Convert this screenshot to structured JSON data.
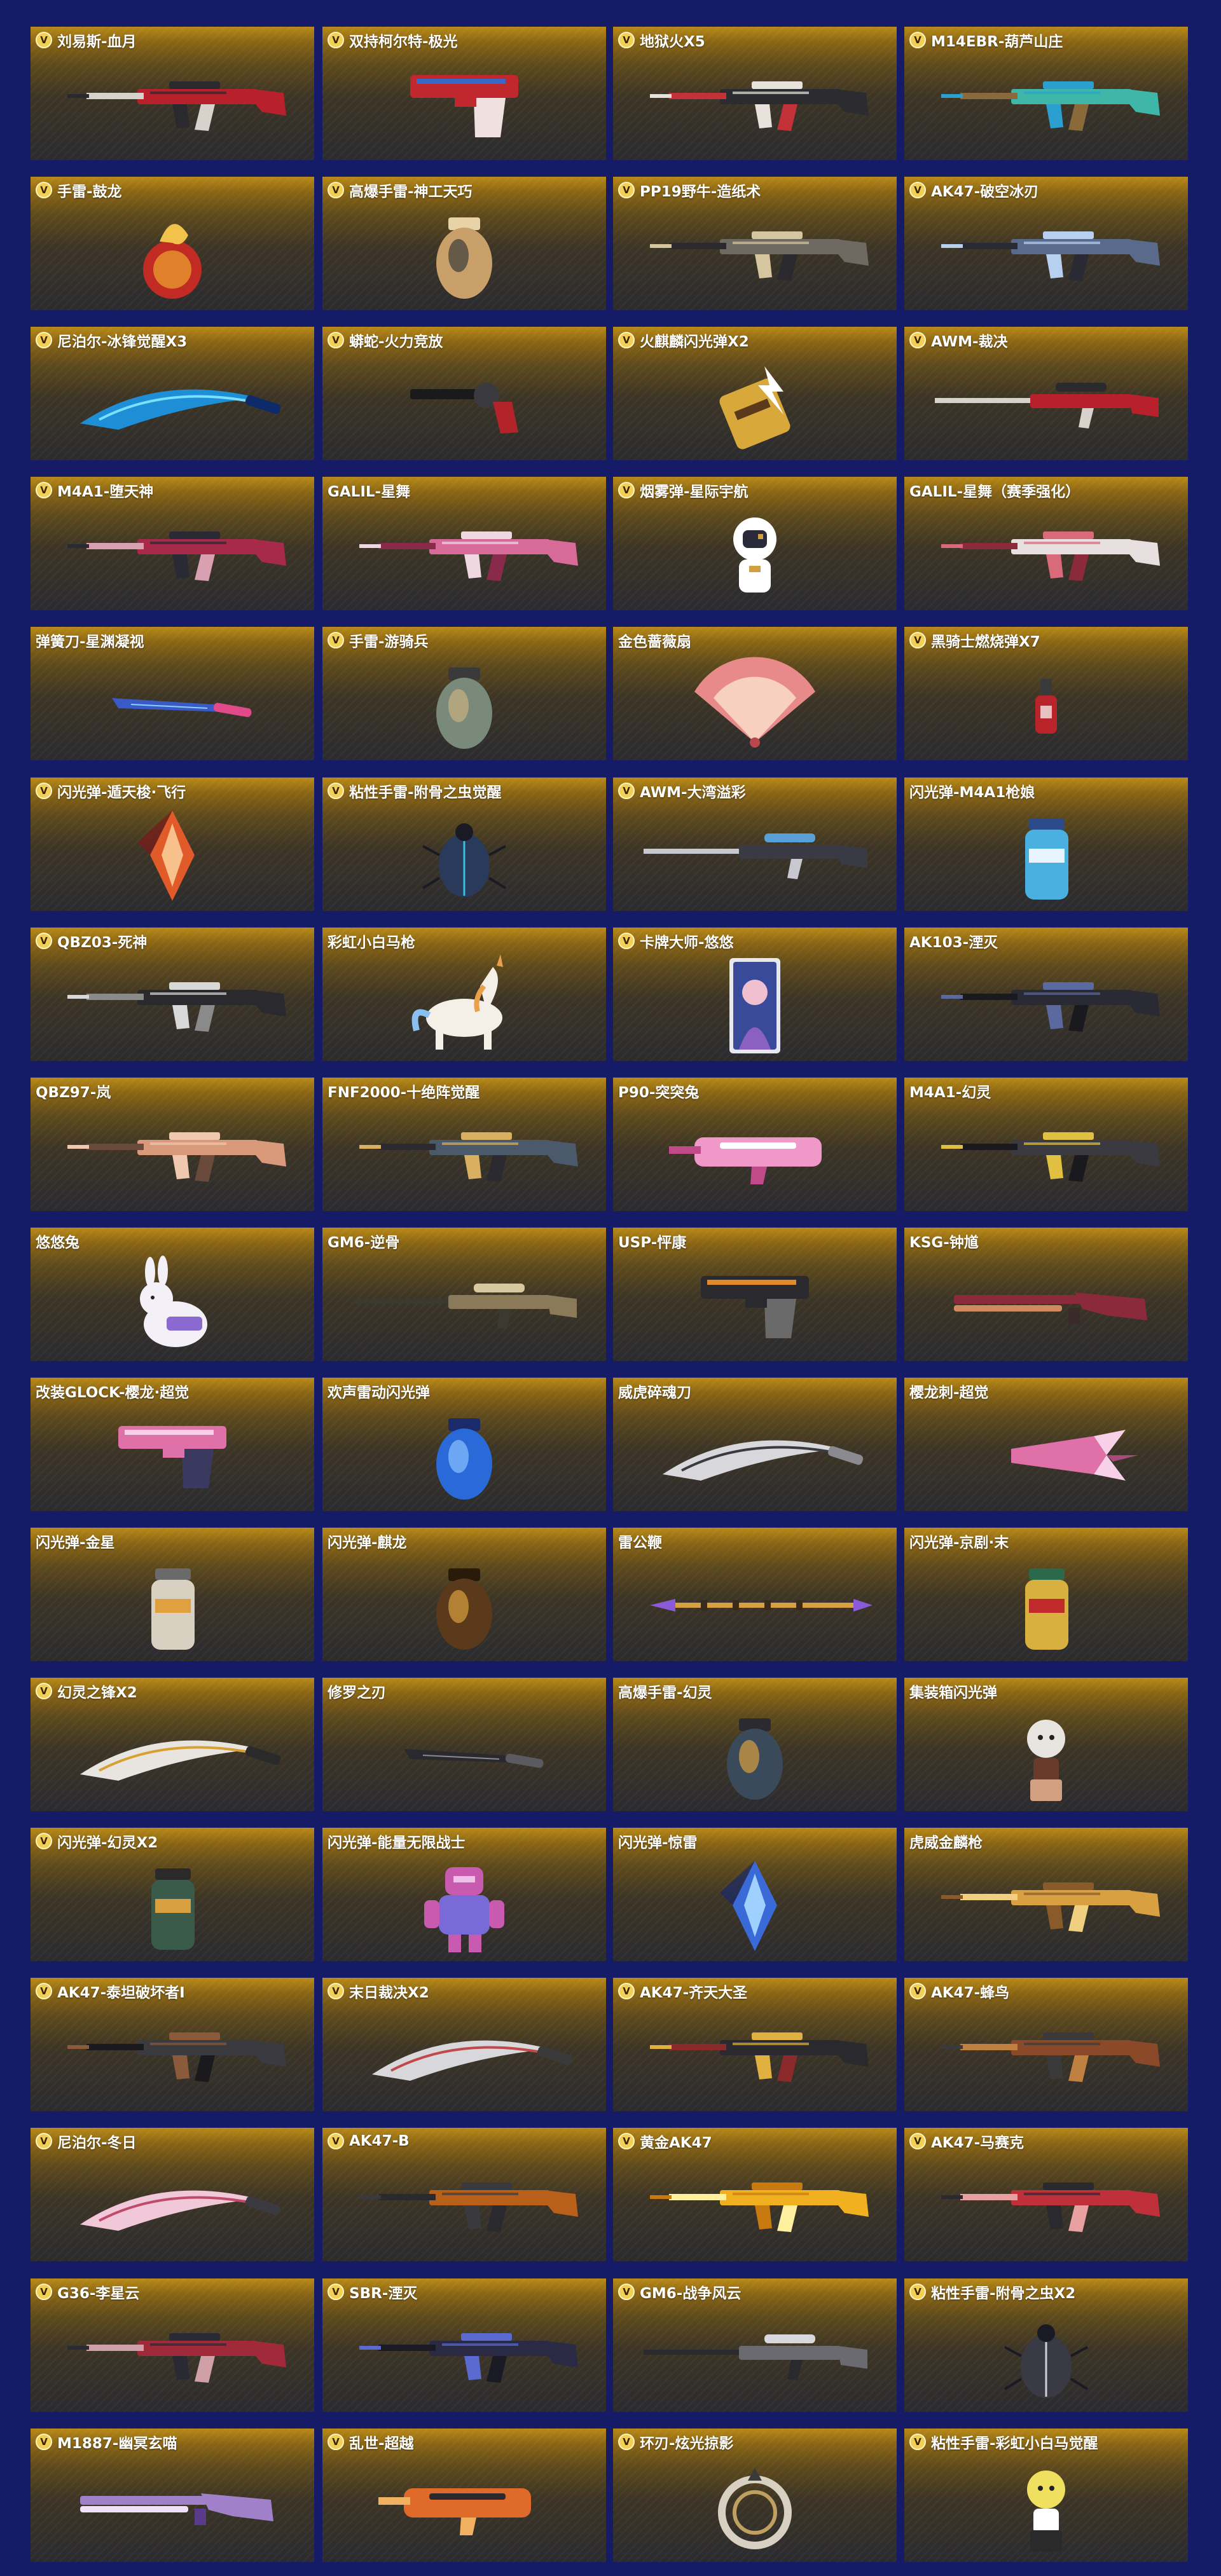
{
  "grid": {
    "items": [
      {
        "name": "刘易斯-血月",
        "badge": "V",
        "icon": "rifle-icon",
        "colors": [
          "#b8212b",
          "#2a2a2e",
          "#d8d2cc"
        ]
      },
      {
        "name": "双持柯尔特-极光",
        "badge": "V",
        "icon": "pistol-icon",
        "colors": [
          "#c0272e",
          "#3a68c8",
          "#f0e0e0"
        ]
      },
      {
        "name": "地狱火X5",
        "badge": "V",
        "icon": "rifle-icon",
        "colors": [
          "#2c2c30",
          "#e8e2dc",
          "#c23238"
        ]
      },
      {
        "name": "M14EBR-葫芦山庄",
        "badge": "V",
        "icon": "rifle-icon",
        "colors": [
          "#3fb7a8",
          "#2b9fd0",
          "#8a6a3a"
        ]
      },
      {
        "name": "手雷-鼓龙",
        "badge": "V",
        "icon": "dragon-grenade-icon",
        "colors": [
          "#e0802a",
          "#c22a24",
          "#f2c24a"
        ]
      },
      {
        "name": "高爆手雷-神工天巧",
        "badge": "V",
        "icon": "grenade-icon",
        "colors": [
          "#c9a06a",
          "#3a3a3a",
          "#e8d2a8"
        ]
      },
      {
        "name": "PP19野牛-造纸术",
        "badge": "V",
        "icon": "rifle-icon",
        "colors": [
          "#6e6a62",
          "#d6c6a0",
          "#2a2a2e"
        ]
      },
      {
        "name": "AK47-破空冰刃",
        "badge": "V",
        "icon": "rifle-icon",
        "colors": [
          "#5a6a8a",
          "#b8d0f0",
          "#2a2a34"
        ]
      },
      {
        "name": "尼泊尔-冰锋觉醒X3",
        "badge": "V",
        "icon": "blade-icon",
        "colors": [
          "#1e8fd6",
          "#7ae0ff",
          "#0d2a6a"
        ]
      },
      {
        "name": "蟒蛇-火力竞放",
        "badge": "V",
        "icon": "revolver-icon",
        "colors": [
          "#3a3a40",
          "#b2242a",
          "#1a1a1a"
        ]
      },
      {
        "name": "火麒麟闪光弹X2",
        "badge": "V",
        "icon": "flashbang-icon",
        "colors": [
          "#d8a83a",
          "#5a3a1a",
          "#ffffff"
        ]
      },
      {
        "name": "AWM-裁决",
        "badge": "V",
        "icon": "sniper-icon",
        "colors": [
          "#b8212b",
          "#2a2a2e",
          "#d8d2cc"
        ]
      },
      {
        "name": "M4A1-堕天神",
        "badge": "V",
        "icon": "rifle-icon",
        "colors": [
          "#a82a4a",
          "#2a2a34",
          "#d8a0b0"
        ]
      },
      {
        "name": "GALIL-星舞",
        "badge": "",
        "icon": "rifle-icon",
        "colors": [
          "#d86a9a",
          "#f0d8e0",
          "#8a2a4a"
        ]
      },
      {
        "name": "烟雾弹-星际宇航",
        "badge": "V",
        "icon": "astronaut-icon",
        "colors": [
          "#ffffff",
          "#d0a040",
          "#2a2a3a"
        ]
      },
      {
        "name": "GALIL-星舞（赛季强化）",
        "badge": "",
        "icon": "rifle-icon",
        "colors": [
          "#e8e0e0",
          "#d86a7a",
          "#8a2a3a"
        ]
      },
      {
        "name": "弹簧刀-星渊凝视",
        "badge": "",
        "icon": "knife-icon",
        "colors": [
          "#3a5ac8",
          "#e04a8a",
          "#8ad0ff"
        ]
      },
      {
        "name": "手雷-游骑兵",
        "badge": "V",
        "icon": "grenade-icon",
        "colors": [
          "#7a8a7a",
          "#c8b080",
          "#3a3a3a"
        ]
      },
      {
        "name": "金色蔷薇扇",
        "badge": "",
        "icon": "fan-icon",
        "colors": [
          "#e88a8a",
          "#f8d0c0",
          "#b8484a"
        ]
      },
      {
        "name": "黑骑士燃烧弹X7",
        "badge": "V",
        "icon": "molotov-icon",
        "colors": [
          "#b8242a",
          "#3a3a3a",
          "#e8c0c0"
        ]
      },
      {
        "name": "闪光弹-遁天梭·飞行",
        "badge": "V",
        "icon": "crystal-icon",
        "colors": [
          "#e05a2a",
          "#f8c08a",
          "#7a1a1a"
        ]
      },
      {
        "name": "粘性手雷-附骨之虫觉醒",
        "badge": "V",
        "icon": "beetle-icon",
        "colors": [
          "#2a3a5a",
          "#3ac0e0",
          "#1a1a24"
        ]
      },
      {
        "name": "AWM-大湾溢彩",
        "badge": "V",
        "icon": "sniper-icon",
        "colors": [
          "#3a3a44",
          "#5aa0d8",
          "#c8c8d0"
        ]
      },
      {
        "name": "闪光弹-M4A1枪娘",
        "badge": "",
        "icon": "canister-icon",
        "colors": [
          "#4ab0e0",
          "#e8f4ff",
          "#2a4a8a"
        ]
      },
      {
        "name": "QBZ03-死神",
        "badge": "V",
        "icon": "rifle-icon",
        "colors": [
          "#2a2a2e",
          "#d8d8d8",
          "#8a8a8a"
        ]
      },
      {
        "name": "彩虹小白马枪",
        "badge": "",
        "icon": "unicorn-icon",
        "colors": [
          "#f4f0e8",
          "#e8a04a",
          "#8ac0f0"
        ]
      },
      {
        "name": "卡牌大师-悠悠",
        "badge": "V",
        "icon": "portrait-card-icon",
        "colors": [
          "#8a60c0",
          "#f0c0d0",
          "#3a4a9a"
        ]
      },
      {
        "name": "AK103-湮灭",
        "badge": "",
        "icon": "rifle-icon",
        "colors": [
          "#2a2a34",
          "#5a6aa0",
          "#1a1a1e"
        ]
      },
      {
        "name": "QBZ97-岚",
        "badge": "",
        "icon": "rifle-icon",
        "colors": [
          "#d89a7a",
          "#f0c8b0",
          "#6a4a3a"
        ]
      },
      {
        "name": "FNF2000-十绝阵觉醒",
        "badge": "",
        "icon": "rifle-icon",
        "colors": [
          "#4a5a6a",
          "#d8b060",
          "#2a2a30"
        ]
      },
      {
        "name": "P90-突突兔",
        "badge": "",
        "icon": "smg-icon",
        "colors": [
          "#f098c8",
          "#ffffff",
          "#c04a8a"
        ]
      },
      {
        "name": "M4A1-幻灵",
        "badge": "",
        "icon": "rifle-icon",
        "colors": [
          "#3a3a40",
          "#e0c040",
          "#1a1a1e"
        ]
      },
      {
        "name": "悠悠兔",
        "badge": "",
        "icon": "rabbit-icon",
        "colors": [
          "#f4f0f8",
          "#8a6ad0",
          "#d0c0f0"
        ]
      },
      {
        "name": "GM6-逆骨",
        "badge": "",
        "icon": "sniper-icon",
        "colors": [
          "#8a7a5a",
          "#d8c8a0",
          "#3a3a30"
        ]
      },
      {
        "name": "USP-怦康",
        "badge": "",
        "icon": "pistol-icon",
        "colors": [
          "#2a2a2e",
          "#e08a2a",
          "#6a6a6a"
        ]
      },
      {
        "name": "KSG-钟馗",
        "badge": "",
        "icon": "shotgun-icon",
        "colors": [
          "#8a2a3a",
          "#d08a60",
          "#3a2a2a"
        ]
      },
      {
        "name": "改装GLOCK-樱龙·超觉",
        "badge": "",
        "icon": "pistol-icon",
        "colors": [
          "#e070a8",
          "#f8d0e8",
          "#3a3a60"
        ]
      },
      {
        "name": "欢声雷动闪光弹",
        "badge": "",
        "icon": "grenade-icon",
        "colors": [
          "#2a6ad8",
          "#8ac0ff",
          "#1a2a6a"
        ]
      },
      {
        "name": "威虎碎魂刀",
        "badge": "",
        "icon": "blade-icon",
        "colors": [
          "#d8d8dc",
          "#3a3a40",
          "#8a8a90"
        ]
      },
      {
        "name": "樱龙刺-超觉",
        "badge": "",
        "icon": "claw-icon",
        "colors": [
          "#e070a8",
          "#f8d0e8",
          "#a84a7a"
        ]
      },
      {
        "name": "闪光弹-金星",
        "badge": "",
        "icon": "canister-icon",
        "colors": [
          "#d8d0c0",
          "#e0a040",
          "#6a6a6a"
        ]
      },
      {
        "name": "闪光弹-麒龙",
        "badge": "",
        "icon": "grenade-icon",
        "colors": [
          "#5a3a1a",
          "#d8a040",
          "#2a1a0a"
        ]
      },
      {
        "name": "雷公鞭",
        "badge": "",
        "icon": "spear-icon",
        "colors": [
          "#d8a040",
          "#8a5ad8",
          "#3a2a1a"
        ]
      },
      {
        "name": "闪光弹-京剧·末",
        "badge": "",
        "icon": "canister-icon",
        "colors": [
          "#d8b040",
          "#c02a2a",
          "#2a6a4a"
        ]
      },
      {
        "name": "幻灵之锋X2",
        "badge": "V",
        "icon": "blade-icon",
        "colors": [
          "#e8e4e0",
          "#d8a030",
          "#2a2a2a"
        ]
      },
      {
        "name": "修罗之刃",
        "badge": "",
        "icon": "knife-icon",
        "colors": [
          "#2a2a2e",
          "#5a5a60",
          "#8a8a90"
        ]
      },
      {
        "name": "高爆手雷-幻灵",
        "badge": "",
        "icon": "grenade-icon",
        "colors": [
          "#3a4a5a",
          "#d8a040",
          "#2a2a30"
        ]
      },
      {
        "name": "集装箱闪光弹",
        "badge": "",
        "icon": "figure-icon",
        "colors": [
          "#e8e4e0",
          "#6a3a2a",
          "#d0a080"
        ]
      },
      {
        "name": "闪光弹-幻灵X2",
        "badge": "V",
        "icon": "canister-icon",
        "colors": [
          "#3a5a4a",
          "#d8a040",
          "#2a2a2a"
        ]
      },
      {
        "name": "闪光弹-能量无限战士",
        "badge": "",
        "icon": "robot-icon",
        "colors": [
          "#c85ab0",
          "#7a6ad8",
          "#f0c0e8"
        ]
      },
      {
        "name": "闪光弹-惊雷",
        "badge": "",
        "icon": "crystal-icon",
        "colors": [
          "#3a6ad8",
          "#a0d0ff",
          "#1a2a6a"
        ]
      },
      {
        "name": "虎威金麟枪",
        "badge": "",
        "icon": "rifle-icon",
        "colors": [
          "#d8a040",
          "#8a5a2a",
          "#f0d080"
        ]
      },
      {
        "name": "AK47-泰坦破坏者Ⅰ",
        "badge": "V",
        "icon": "rifle-icon",
        "colors": [
          "#3a3a40",
          "#8a5a3a",
          "#1a1a1e"
        ]
      },
      {
        "name": "末日裁决X2",
        "badge": "V",
        "icon": "blade-icon",
        "colors": [
          "#d8d8dc",
          "#c04a4a",
          "#3a3a3a"
        ]
      },
      {
        "name": "AK47-齐天大圣",
        "badge": "V",
        "icon": "rifle-icon",
        "colors": [
          "#2a2a2e",
          "#e0b040",
          "#8a2a2a"
        ]
      },
      {
        "name": "AK47-蜂鸟",
        "badge": "V",
        "icon": "rifle-icon",
        "colors": [
          "#8a4a2a",
          "#3a3a3a",
          "#c08040"
        ]
      },
      {
        "name": "尼泊尔-冬日",
        "badge": "V",
        "icon": "blade-icon",
        "colors": [
          "#f0c8d8",
          "#c04a6a",
          "#3a3a40"
        ]
      },
      {
        "name": "AK47-B",
        "badge": "V",
        "icon": "rifle-icon",
        "colors": [
          "#b8601a",
          "#3a3a3e",
          "#2a2a2e"
        ]
      },
      {
        "name": "黄金AK47",
        "badge": "V",
        "icon": "rifle-icon",
        "colors": [
          "#f0b020",
          "#c87a10",
          "#fff0a0"
        ]
      },
      {
        "name": "AK47-马赛克",
        "badge": "V",
        "icon": "rifle-icon",
        "colors": [
          "#c0303a",
          "#2a2a2e",
          "#e8a0a0"
        ]
      },
      {
        "name": "G36-李星云",
        "badge": "V",
        "icon": "rifle-icon",
        "colors": [
          "#a02a3a",
          "#2a2a34",
          "#d0a0a8"
        ]
      },
      {
        "name": "SBR-湮灭",
        "badge": "V",
        "icon": "rifle-icon",
        "colors": [
          "#2a2a44",
          "#5a6ad0",
          "#1a1a24"
        ]
      },
      {
        "name": "GM6-战争风云",
        "badge": "V",
        "icon": "sniper-icon",
        "colors": [
          "#6a6a70",
          "#d8d8dc",
          "#2a2a2e"
        ]
      },
      {
        "name": "粘性手雷-附骨之虫X2",
        "badge": "V",
        "icon": "beetle-icon",
        "colors": [
          "#3a3a44",
          "#d0d0d8",
          "#1a1a24"
        ]
      },
      {
        "name": "M1887-幽冥玄喵",
        "badge": "V",
        "icon": "shotgun-icon",
        "colors": [
          "#a080c8",
          "#f0e0f8",
          "#5a3a8a"
        ]
      },
      {
        "name": "乱世-超越",
        "badge": "V",
        "icon": "smg-icon",
        "colors": [
          "#e06a2a",
          "#2a2a2e",
          "#f0b060"
        ]
      },
      {
        "name": "环刃-炫光掠影",
        "badge": "V",
        "icon": "ring-blade-icon",
        "colors": [
          "#d8d0c0",
          "#c0a060",
          "#3a3a3a"
        ]
      },
      {
        "name": "粘性手雷-彩虹小白马觉醒",
        "badge": "V",
        "icon": "figure-icon",
        "colors": [
          "#f0e060",
          "#ffffff",
          "#2a2a2a"
        ]
      }
    ]
  }
}
